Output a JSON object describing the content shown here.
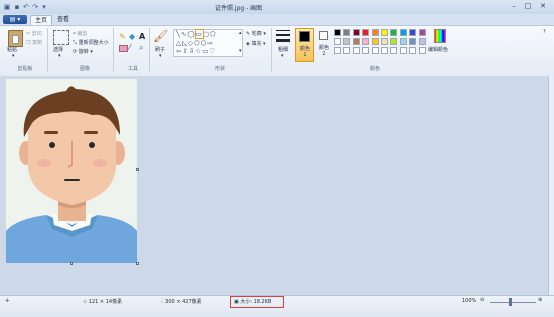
{
  "window": {
    "title": "证件照.jpg - 画图",
    "buttons": {
      "minimize": "–",
      "maximize": "□",
      "close": "✕"
    }
  },
  "tabs": {
    "file": "",
    "home": "主页",
    "view": "查看"
  },
  "clipboard": {
    "paste": "粘贴",
    "cut": "剪切",
    "copy": "复制",
    "label": "剪贴板"
  },
  "image": {
    "select": "选择",
    "crop": "裁剪",
    "resize": "重新调整大小",
    "rotate": "旋转",
    "label": "图像"
  },
  "tools": {
    "label": "工具"
  },
  "shapes": {
    "brushes": "刷子",
    "outline": "轮廓",
    "fill": "填充",
    "label": "形状"
  },
  "size": {
    "label": "粗细"
  },
  "colors": {
    "color1": "颜色 1",
    "color2": "颜色 2",
    "edit": "编辑颜色",
    "label": "颜色",
    "color1_value": "#000000",
    "color2_value": "#ffffff",
    "palette_row1": [
      "#000000",
      "#7f7f7f",
      "#880015",
      "#ed1c24",
      "#ff7f27",
      "#fff200",
      "#22b14c",
      "#00a2e8",
      "#3f48cc",
      "#a349a4"
    ],
    "palette_row2": [
      "#ffffff",
      "#c3c3c3",
      "#b97a57",
      "#ffaec9",
      "#ffc90e",
      "#efe4b0",
      "#b5e61d",
      "#99d9ea",
      "#7092be",
      "#c8bfe7"
    ],
    "palette_row3": [
      "#ffffff",
      "#ffffff",
      "#ffffff",
      "#ffffff",
      "#ffffff",
      "#ffffff",
      "#ffffff",
      "#ffffff",
      "#ffffff",
      "#ffffff"
    ]
  },
  "status": {
    "cursor": "121 × 14像素",
    "dimensions": "300 × 427像素",
    "filesize": "大小: 18.2KB",
    "zoom": "100%"
  }
}
